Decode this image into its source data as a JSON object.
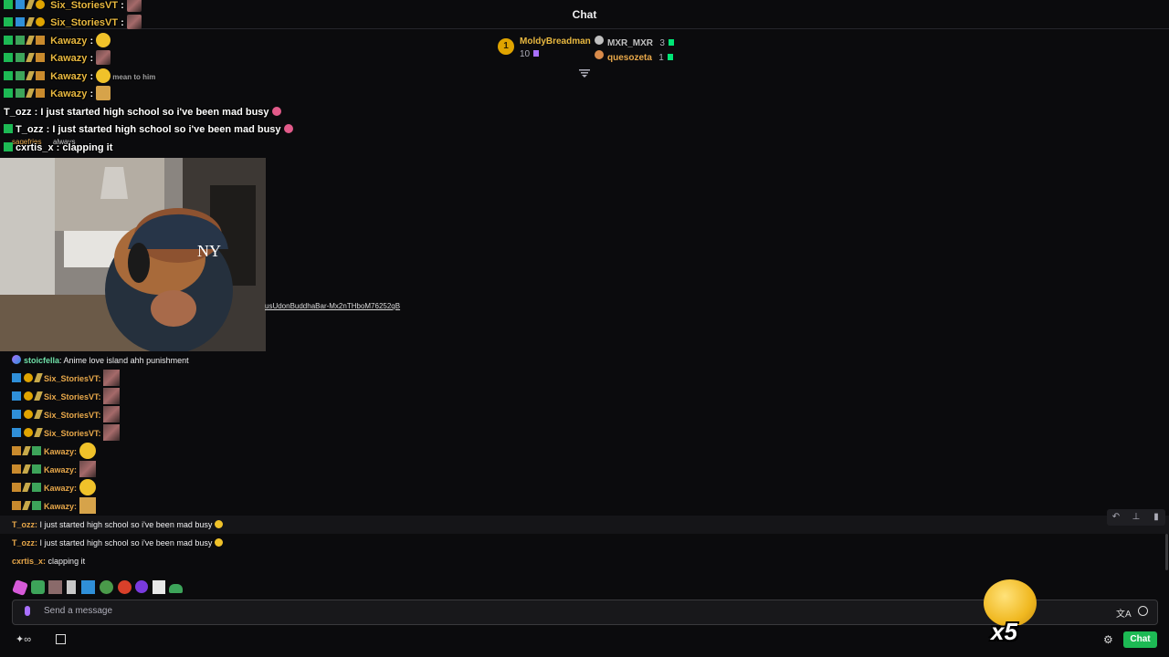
{
  "header": {
    "title": "Chat"
  },
  "leaderboard": [
    {
      "rank": "1",
      "name": "MoldyBreadman",
      "count": "10"
    },
    {
      "name": "MXR_MXR",
      "count": "3"
    },
    {
      "name": "quesozeta",
      "count": "1"
    }
  ],
  "overlay_chat": [
    {
      "user": "Six_StoriesVT",
      "sep": ":",
      "text": ""
    },
    {
      "user": "Six_StoriesVT",
      "sep": ":",
      "text": ""
    },
    {
      "user": "Kawazy",
      "sep": ":",
      "text": ""
    },
    {
      "user": "Kawazy",
      "sep": ":",
      "text": ""
    },
    {
      "user": "Kawazy",
      "sep": ":",
      "text": ""
    },
    {
      "user": "Kawazy",
      "sep": ":",
      "text": ""
    },
    {
      "user": "T_ozz",
      "sep": ":",
      "text": "I just started high school so i've been mad busy"
    },
    {
      "user": "T_ozz",
      "sep": ":",
      "text": "I just started high school so i've been mad busy"
    },
    {
      "user": "cxrtis_x",
      "sep": ":",
      "text": "clapping it"
    }
  ],
  "overlay_ghost": {
    "sagefries": "sagefries",
    "always": "always",
    "meanto": "mean to him"
  },
  "link_text": "usUdonBuddhaBar-Mx2nTHboM76252qB",
  "chat_messages": [
    {
      "user": "stoicfella",
      "text": "Anime love island ahh punishment",
      "color": "#6fe0a8"
    },
    {
      "user": "Six_StoriesVT:",
      "text": "",
      "color": "#e8a84a"
    },
    {
      "user": "Six_StoriesVT:",
      "text": "",
      "color": "#e8a84a"
    },
    {
      "user": "Six_StoriesVT:",
      "text": "",
      "color": "#e8a84a"
    },
    {
      "user": "Six_StoriesVT:",
      "text": "",
      "color": "#e8a84a"
    },
    {
      "user": "Kawazy:",
      "text": "",
      "color": "#e8a84a"
    },
    {
      "user": "Kawazy:",
      "text": "",
      "color": "#e8a84a"
    },
    {
      "user": "Kawazy:",
      "text": "",
      "color": "#e8a84a"
    },
    {
      "user": "Kawazy:",
      "text": "",
      "color": "#e8a84a"
    },
    {
      "user": "T_ozz:",
      "text": "I just started high school so i've been mad busy",
      "color": "#e8a84a"
    },
    {
      "user": "T_ozz:",
      "text": "I just started high school so i've been mad busy",
      "color": "#e8a84a"
    },
    {
      "user": "cxrtis_x:",
      "text": "clapping it",
      "color": "#e8a84a"
    }
  ],
  "input": {
    "placeholder": "Send a message"
  },
  "combo": {
    "label": "x5"
  },
  "footer": {
    "chat_button": "Chat"
  },
  "colors": {
    "accent": "#1db954",
    "background": "#0b0b0d"
  }
}
